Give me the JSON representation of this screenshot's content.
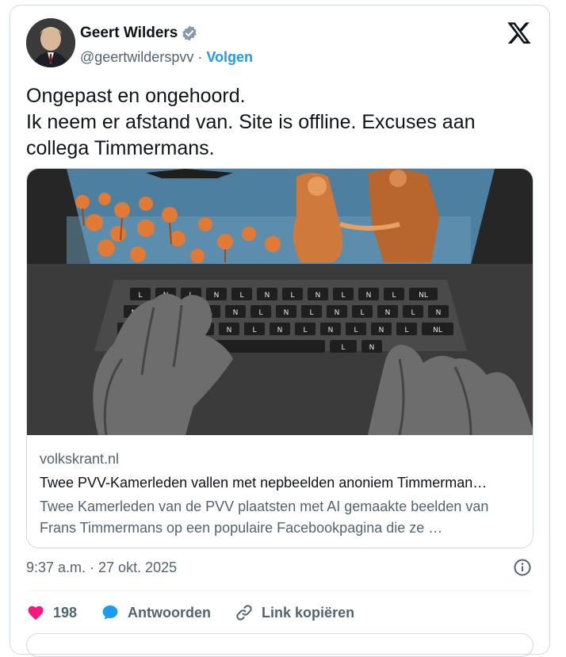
{
  "author": {
    "name": "Geert Wilders",
    "handle": "@geertwilderspvv",
    "separator": "·",
    "follow_label": "Volgen",
    "verified": true
  },
  "tweet": {
    "text": "Ongepast en ongehoord.\nIk neem er afstand van. Site is offline. Excuses aan collega Timmermans."
  },
  "link_card": {
    "domain": "volkskrant.nl",
    "headline": "Twee PVV-Kamerleden vallen met nepbeelden anoniem Timmerman…",
    "description": "Twee Kamerleden van de PVV plaatsten met AI gemaakte beelden van Frans Timmermans op een populaire Facebookpagina die ze …",
    "image_subject": "laptop with NL keyboard and hands, tulip field and figures on screen",
    "key_label_nl": "NL",
    "key_label_n": "N",
    "key_label_l": "L"
  },
  "meta": {
    "timestamp": "9:37 a.m. · 27 okt. 2025"
  },
  "actions": {
    "like_count": "198",
    "reply_label": "Antwoorden",
    "copy_link_label": "Link kopiëren"
  },
  "colors": {
    "accent": "#1d9bf0",
    "like": "#f91880",
    "text_primary": "#0f1419",
    "text_secondary": "#536471",
    "border": "#cfd9de"
  },
  "icons": {
    "verified": "verified-badge-icon",
    "brand": "x-logo-icon",
    "info": "info-icon",
    "like": "heart-icon",
    "reply": "speech-bubble-icon",
    "copy_link": "link-icon"
  }
}
